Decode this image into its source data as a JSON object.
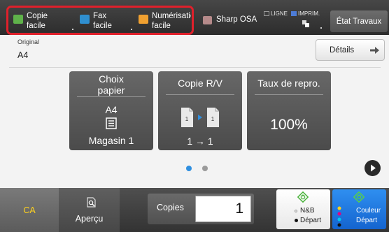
{
  "topbar": {
    "quick_buttons": [
      {
        "label_line1": "Copie",
        "label_line2": "facile",
        "icon": "copy-icon",
        "color": "#5fb24a"
      },
      {
        "label_line1": "Fax",
        "label_line2": "facile",
        "icon": "fax-icon",
        "color": "#2f8fd0"
      },
      {
        "label_line1": "Numérisation",
        "label_line2": "facile",
        "icon": "scan-icon",
        "color": "#f0a030"
      }
    ],
    "highlight_color": "#e0202b",
    "osa": {
      "label": "Sharp OSA",
      "icon": "osa-icon"
    },
    "indicators": {
      "line": "LIGNE",
      "print": "IMPRIM.",
      "print_color": "#4d7cd6"
    },
    "job_status": "État Travaux"
  },
  "original": {
    "label": "Original",
    "value": "A4"
  },
  "details_button": "Détails",
  "cards": {
    "paper": {
      "title_line1": "Choix",
      "title_line2": "papier",
      "size": "A4",
      "tray": "Magasin 1",
      "icon": "paper-tray-icon"
    },
    "duplex": {
      "title": "Copie R/V",
      "value": "1 → 1",
      "icon": "duplex-copy-icon"
    },
    "ratio": {
      "title": "Taux de repro.",
      "value": "100%"
    }
  },
  "pager": {
    "active_color": "#2f8fe0",
    "inactive_color": "#9b9b9b"
  },
  "bottom": {
    "ca": "CA",
    "preview": "Aperçu",
    "copies_label": "Copies",
    "copies_value": "1",
    "bw_start": {
      "line1": "N&B",
      "line2": "Départ"
    },
    "color_start": {
      "line1": "Couleur",
      "line2": "Départ"
    }
  }
}
